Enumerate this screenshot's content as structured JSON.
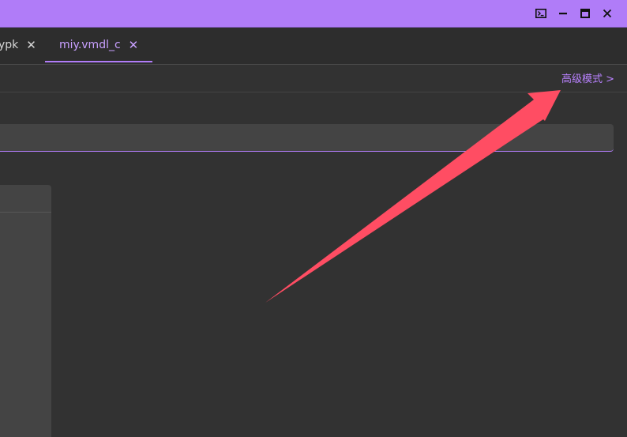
{
  "window": {
    "controls": [
      {
        "name": "terminal-icon"
      },
      {
        "name": "minimize-icon"
      },
      {
        "name": "maximize-icon"
      },
      {
        "name": "close-icon"
      }
    ]
  },
  "tabs": [
    {
      "label": "ypk",
      "active": false
    },
    {
      "label": "miy.vmdl_c",
      "active": true
    }
  ],
  "toolbar": {
    "advanced_mode": "高级模式 >"
  },
  "colors": {
    "accent": "#b07cf8",
    "annotation_arrow": "#ff4d63",
    "background": "#323232"
  }
}
